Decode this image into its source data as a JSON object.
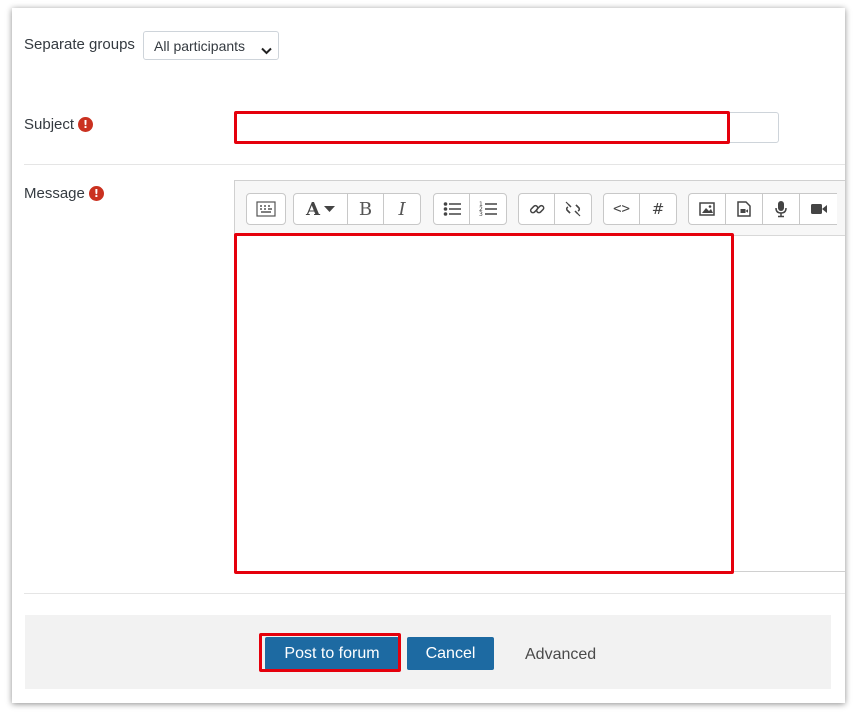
{
  "form": {
    "groups_label": "Separate groups",
    "groups_selected": "All participants",
    "subject_label": "Subject",
    "subject_value": "",
    "message_label": "Message",
    "required_symbol": "!",
    "post_label": "Post to forum",
    "cancel_label": "Cancel",
    "advanced_label": "Advanced"
  },
  "editor": {
    "toolbar_icons": [
      "toggle-toolbar-icon",
      "font-style-icon",
      "bold-icon",
      "italic-icon",
      "unordered-list-icon",
      "ordered-list-icon",
      "link-icon",
      "unlink-icon",
      "html-icon",
      "hashtag-icon",
      "image-icon",
      "media-icon",
      "record-audio-icon",
      "record-video-icon"
    ],
    "bold_glyph": "B",
    "italic_glyph": "I",
    "font_glyph": "A",
    "hash_glyph": "#",
    "html_glyph": "<>"
  },
  "colors": {
    "highlight": "#e5000c",
    "button": "#1d6aa2",
    "required": "#ca3120"
  }
}
